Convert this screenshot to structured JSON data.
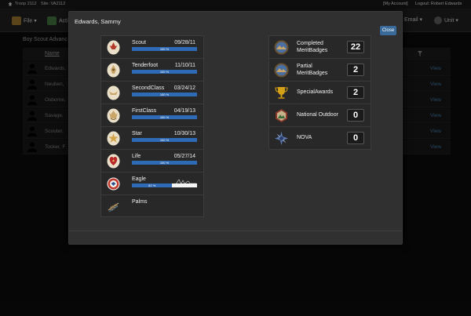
{
  "topbar": {
    "troop": "Troop 2112",
    "site": "Site: VA2112",
    "account": "[My Account]",
    "logout": "Logout: Robert Edwards"
  },
  "menubar": {
    "file": "File ▾",
    "activities": "Acti",
    "email": "Email ▾",
    "unit": "Unit ▾"
  },
  "background": {
    "title": "Boy Scout Advanc",
    "column_name": "Name",
    "rows": [
      {
        "name": "Edwards,",
        "view": "View"
      },
      {
        "name": "Neuben,",
        "view": "View"
      },
      {
        "name": "Osborne,",
        "view": "View"
      },
      {
        "name": "Savage, ",
        "view": "View"
      },
      {
        "name": "Scouter,",
        "view": "View"
      },
      {
        "name": "Tocker, F",
        "view": "View"
      }
    ]
  },
  "modal": {
    "title": "Edwards, Sammy",
    "close_label": "Close",
    "ranks": [
      {
        "name": "Scout",
        "date": "09/28/11",
        "percent_label": "100 %",
        "progress": 1.0,
        "color": "#b33a2b"
      },
      {
        "name": "Tenderfoot",
        "date": "11/10/11",
        "percent_label": "100 %",
        "progress": 1.0,
        "color": "#c9a56a"
      },
      {
        "name": "SecondClass",
        "date": "03/24/12",
        "percent_label": "100 %",
        "progress": 1.0,
        "color": "#c9a56a"
      },
      {
        "name": "FirstClass",
        "date": "04/19/13",
        "percent_label": "100 %",
        "progress": 1.0,
        "color": "#c9a56a"
      },
      {
        "name": "Star",
        "date": "10/30/13",
        "percent_label": "100 %",
        "progress": 1.0,
        "color": "#d4a44a"
      },
      {
        "name": "Life",
        "date": "05/27/14",
        "percent_label": "100 %",
        "progress": 1.0,
        "color": "#b8282a"
      },
      {
        "name": "Eagle",
        "date": "",
        "percent_label": "62 %",
        "progress": 0.62,
        "color": "#c0392b"
      },
      {
        "name": "Palms",
        "date": "",
        "percent_label": "",
        "progress": null,
        "color": "#b9a27a"
      }
    ],
    "awards": [
      {
        "label": "Completed MeritBadges",
        "count": "22"
      },
      {
        "label": "Partial MeritBadges",
        "count": "2"
      },
      {
        "label": "SpecialAwards",
        "count": "2"
      },
      {
        "label": "National Outdoor",
        "count": "0"
      },
      {
        "label": "NOVA",
        "count": "0"
      }
    ]
  },
  "colors": {
    "accent": "#3a6a9a",
    "progress": "#2e6ab5",
    "link": "#3e6f98"
  }
}
